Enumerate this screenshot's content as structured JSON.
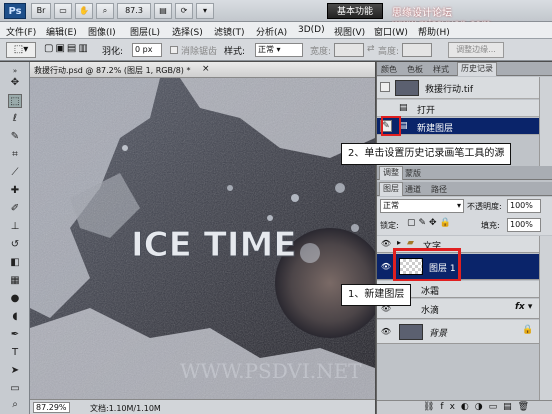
{
  "app": {
    "logo": "Ps",
    "zoom_display": "87.3",
    "workspace_button": "基本功能",
    "watermark": "思缘设计论坛 www.missyuan.com"
  },
  "menu": [
    "文件(F)",
    "编辑(E)",
    "图像(I)",
    "图层(L)",
    "选择(S)",
    "滤镜(T)",
    "分析(A)",
    "3D(D)",
    "视图(V)",
    "窗口(W)",
    "帮助(H)"
  ],
  "options": {
    "feather_label": "羽化:",
    "feather_value": "0 px",
    "antialias_label": "消除锯齿",
    "style_label": "样式:",
    "style_value": "正常",
    "width_label": "宽度:",
    "height_label": "高度:",
    "refine_edge_button": "调整边缘..."
  },
  "document": {
    "tab_title": "救援行动.psd @ 87.2% (图层 1, RGB/8) *",
    "zoom_status": "87.29%",
    "doc_size": "文档:1.10M/1.10M",
    "artwork_text": "ICE TIME",
    "bottom_watermark": "WWW.PSDVI.NET"
  },
  "history_panel": {
    "tabs": [
      "颜色",
      "色板",
      "样式",
      "历史记录"
    ],
    "snapshot_name": "救援行动.tif",
    "items": [
      {
        "label": "打开",
        "selected": false
      },
      {
        "label": "新建图层",
        "selected": true
      }
    ]
  },
  "adjust_tabs": [
    "调整",
    "蒙版"
  ],
  "layers_panel": {
    "tabs": [
      "图层",
      "通道",
      "路径"
    ],
    "blend_mode": "正常",
    "opacity_label": "不透明度:",
    "opacity_value": "100%",
    "lock_label": "锁定:",
    "fill_label": "填充:",
    "fill_value": "100%",
    "layers": [
      {
        "name": "文字",
        "type": "group",
        "selected": false
      },
      {
        "name": "图层 1",
        "type": "layer",
        "selected": true
      },
      {
        "name": "冰霜",
        "type": "layer",
        "selected": false
      },
      {
        "name": "水滴",
        "type": "group",
        "selected": false
      },
      {
        "name": "背景",
        "type": "background",
        "selected": false
      }
    ]
  },
  "callouts": {
    "step2": "2、单击设置历史记录画笔工具的源",
    "step1": "1、新建图层"
  },
  "colors": {
    "selection_blue": "#0a246a",
    "highlight_red": "#e02020"
  }
}
